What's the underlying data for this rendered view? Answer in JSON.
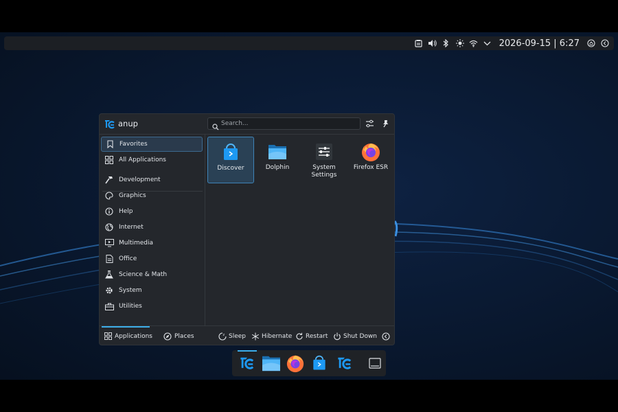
{
  "top_panel": {
    "clock": "2026-09-15 | 6:27",
    "tray_icons": [
      "clipboard-icon",
      "volume-icon",
      "bluetooth-icon",
      "brightness-icon",
      "wifi-icon",
      "expand-tray-icon",
      "updates-icon",
      "notifications-icon"
    ]
  },
  "launcher": {
    "user_name": "anup",
    "search_placeholder": "Search...",
    "categories": [
      {
        "label": "Favorites",
        "icon": "bookmark-icon"
      },
      {
        "label": "All Applications",
        "icon": "grid-icon"
      },
      {
        "label": "Development",
        "icon": "hammer-icon"
      },
      {
        "label": "Graphics",
        "icon": "palette-icon"
      },
      {
        "label": "Help",
        "icon": "info-icon"
      },
      {
        "label": "Internet",
        "icon": "globe-icon"
      },
      {
        "label": "Multimedia",
        "icon": "monitor-play-icon"
      },
      {
        "label": "Office",
        "icon": "document-icon"
      },
      {
        "label": "Science & Math",
        "icon": "flask-icon"
      },
      {
        "label": "System",
        "icon": "gear-icon"
      },
      {
        "label": "Utilities",
        "icon": "toolbox-icon"
      }
    ],
    "apps": [
      {
        "label": "Discover",
        "icon": "discover-icon"
      },
      {
        "label": "Dolphin",
        "icon": "folder-icon"
      },
      {
        "label": "System Settings",
        "icon": "settings-icon"
      },
      {
        "label": "Firefox ESR",
        "icon": "firefox-icon"
      }
    ],
    "footer_tabs": {
      "applications": "Applications",
      "places": "Places"
    },
    "power": {
      "sleep": "Sleep",
      "hibernate": "Hibernate",
      "restart": "Restart",
      "shutdown": "Shut Down"
    }
  },
  "taskbar": {
    "items": [
      "launcher-icon",
      "dolphin-icon",
      "firefox-icon",
      "discover-icon",
      "launcher-icon",
      "show-desktop-icon"
    ]
  },
  "colors": {
    "accent": "#3daee9",
    "panel": "#1c1f24",
    "menu_bg": "#24272c"
  }
}
